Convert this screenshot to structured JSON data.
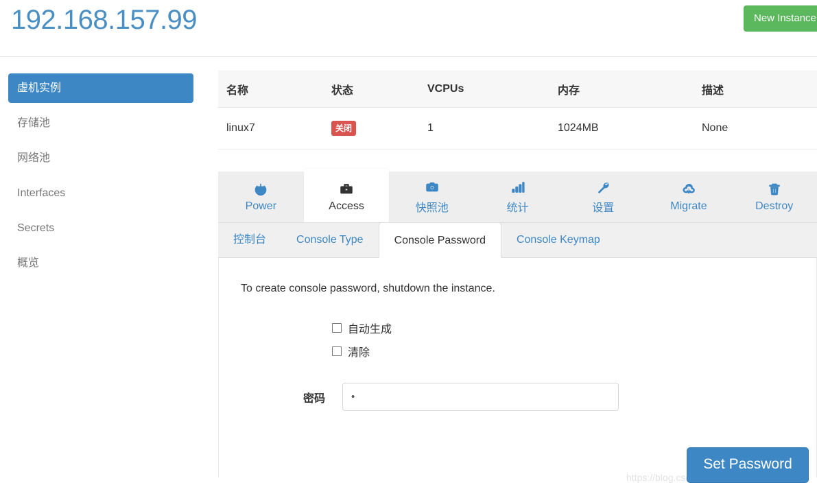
{
  "header": {
    "title": "192.168.157.99",
    "title_color": "#4a8fc4",
    "new_instance_label": "New Instance",
    "new_instance_color": "#5cb85c"
  },
  "sidebar": {
    "items": [
      {
        "label": "虚机实例",
        "name": "sidebar-item-instances",
        "active": true
      },
      {
        "label": "存储池",
        "name": "sidebar-item-storage",
        "active": false
      },
      {
        "label": "网络池",
        "name": "sidebar-item-network",
        "active": false
      },
      {
        "label": "Interfaces",
        "name": "sidebar-item-interfaces",
        "active": false
      },
      {
        "label": "Secrets",
        "name": "sidebar-item-secrets",
        "active": false
      },
      {
        "label": "概览",
        "name": "sidebar-item-overview",
        "active": false
      }
    ],
    "active_color": "#3d87c4"
  },
  "instance_table": {
    "columns": [
      "名称",
      "状态",
      "VCPUs",
      "内存",
      "描述"
    ],
    "rows": [
      {
        "name": "linux7",
        "state": "关闭",
        "state_color": "#d9534f",
        "vcpus": "1",
        "memory": "1024MB",
        "description": "None"
      }
    ]
  },
  "main_tabs": [
    {
      "label": "Power",
      "icon": "power-icon",
      "active": false
    },
    {
      "label": "Access",
      "icon": "briefcase-icon",
      "active": true
    },
    {
      "label": "快照池",
      "icon": "camera-icon",
      "active": false
    },
    {
      "label": "统计",
      "icon": "bar-chart-icon",
      "active": false
    },
    {
      "label": "设置",
      "icon": "wrench-icon",
      "active": false
    },
    {
      "label": "Migrate",
      "icon": "cloud-download-icon",
      "active": false
    },
    {
      "label": "Destroy",
      "icon": "trash-icon",
      "active": false
    }
  ],
  "sub_tabs": [
    {
      "label": "控制台",
      "active": false
    },
    {
      "label": "Console Type",
      "active": false
    },
    {
      "label": "Console Password",
      "active": true
    },
    {
      "label": "Console Keymap",
      "active": false
    }
  ],
  "console_password_panel": {
    "notice": "To create console password, shutdown the instance.",
    "checkboxes": [
      {
        "label": "自动生成",
        "checked": false
      },
      {
        "label": "清除",
        "checked": false
      }
    ],
    "password_label": "密码",
    "password_value": "•",
    "password_placeholder": "",
    "submit_label": "Set Password",
    "submit_color": "#3d87c4"
  },
  "watermark": "https://blog.csdn.net/weixin_43695104"
}
